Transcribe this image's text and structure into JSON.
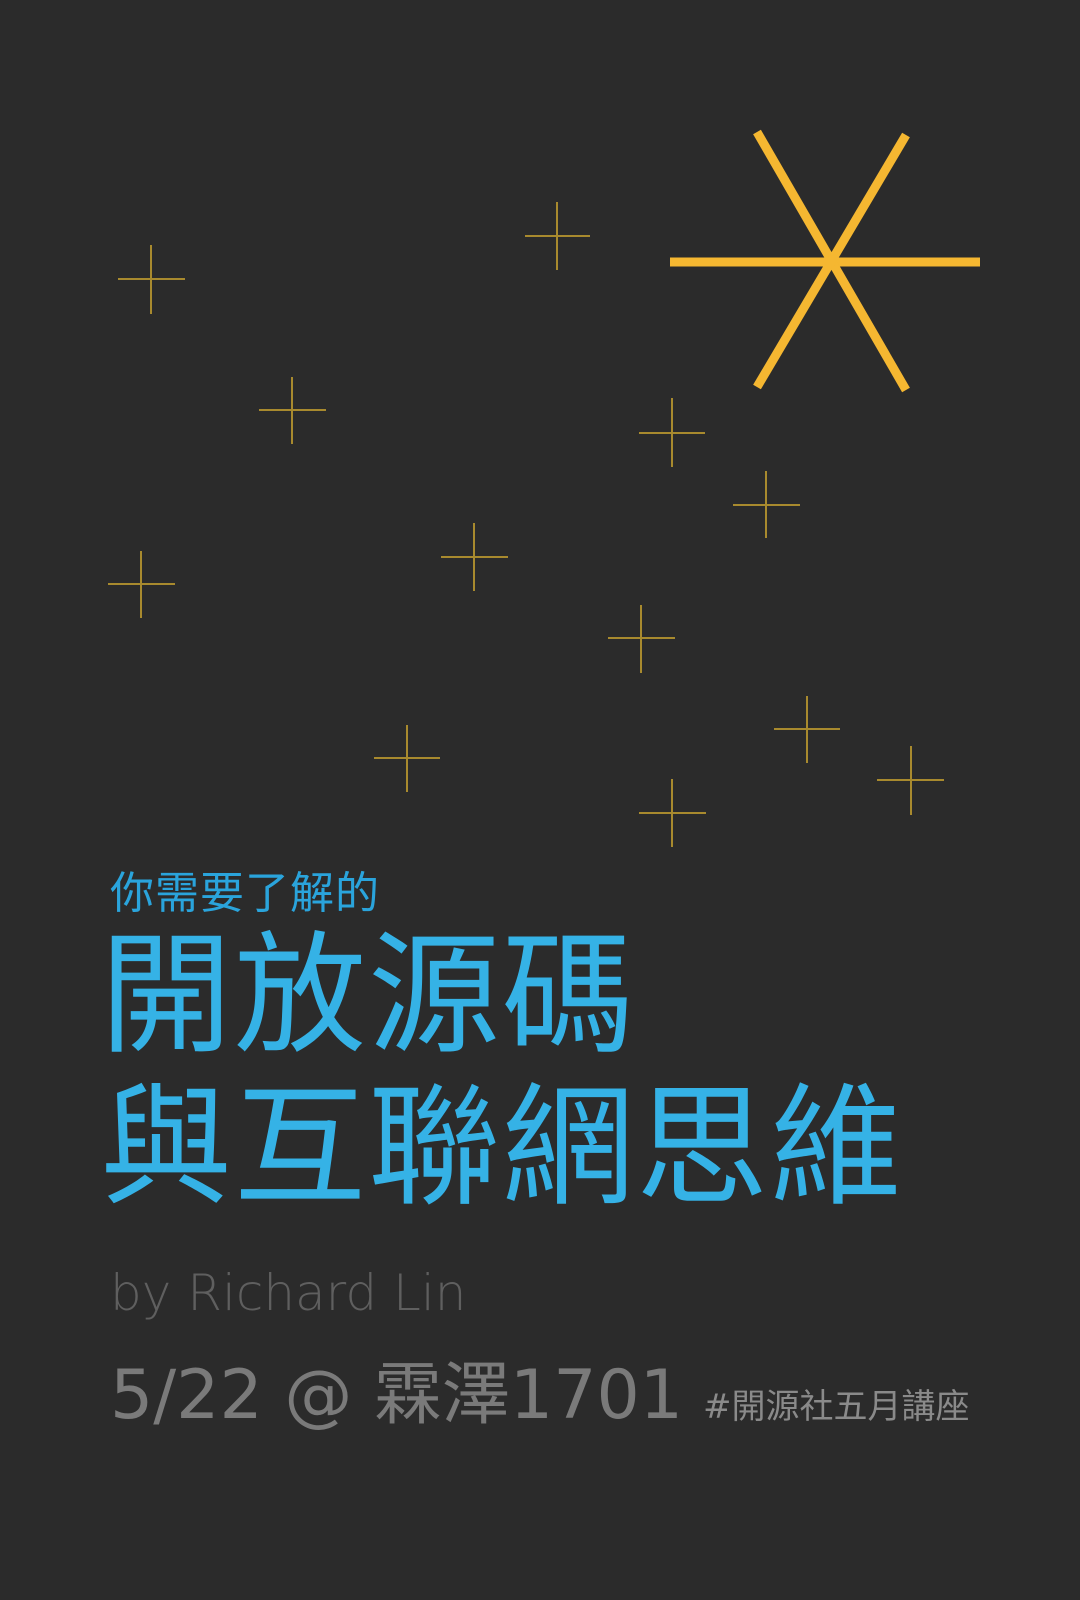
{
  "poster": {
    "subtitle": "你需要了解的",
    "title_line_1": "開放源碼",
    "title_line_2": "與互聯網思維",
    "byline": "by Richard Lin",
    "event_info": "5/22 @ 霖澤1701",
    "hashtag": "#開源社五月講座"
  },
  "colors": {
    "background": "#2b2b2b",
    "title": "#35b2e6",
    "subtitle": "#2aa4dc",
    "star_big": "#f5b731",
    "star_small": "#a88a2e",
    "byline": "#5f5f5f",
    "event": "#7a7a7a"
  },
  "icons": {
    "big_star": "asterisk-star-icon",
    "small_star": "plus-sparkle-icon"
  }
}
